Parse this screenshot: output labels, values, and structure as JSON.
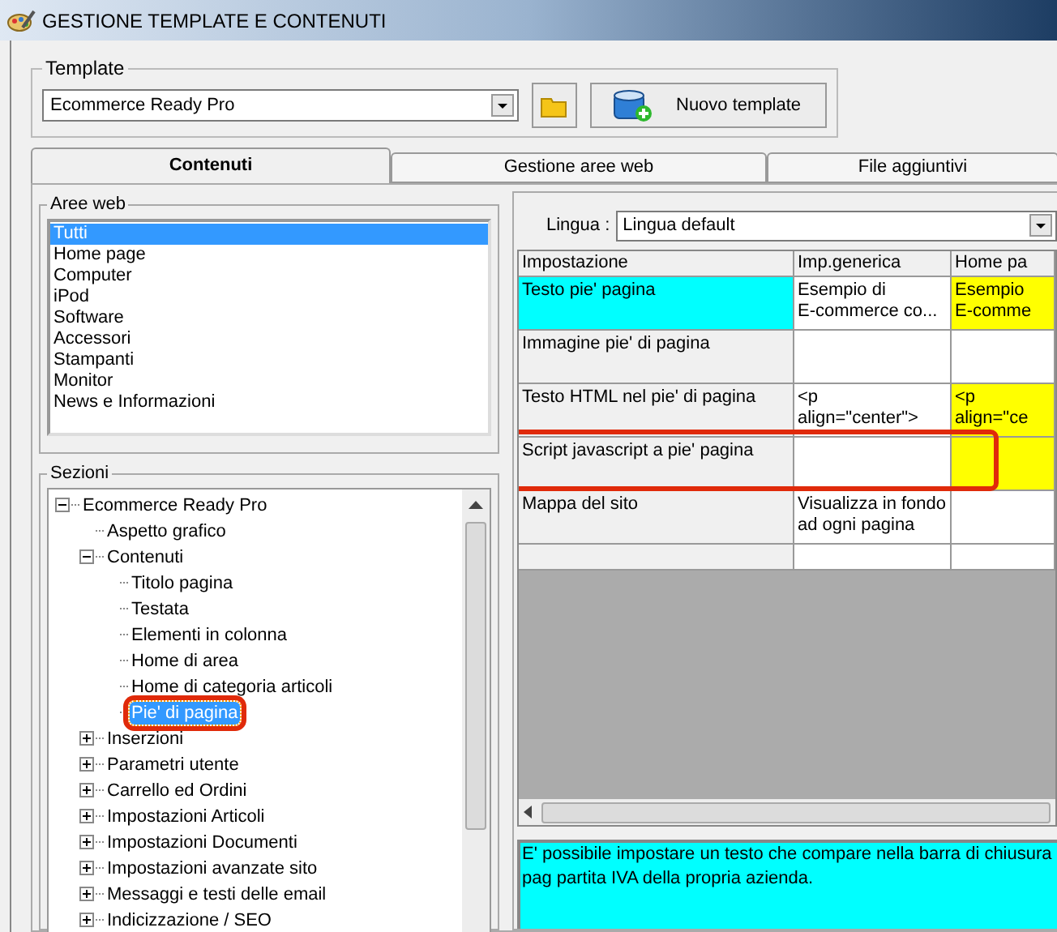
{
  "window": {
    "title": "GESTIONE TEMPLATE E CONTENUTI"
  },
  "template": {
    "label": "Template",
    "value": "Ecommerce Ready Pro",
    "new_button": "Nuovo template"
  },
  "tabs": [
    {
      "label": "Contenuti",
      "selected": true
    },
    {
      "label": "Gestione aree web",
      "selected": false
    },
    {
      "label": "File aggiuntivi",
      "selected": false
    }
  ],
  "aree_web": {
    "label": "Aree web",
    "items": [
      {
        "label": "Tutti",
        "selected": true
      },
      {
        "label": "Home page",
        "selected": false
      },
      {
        "label": "Computer",
        "selected": false
      },
      {
        "label": "iPod",
        "selected": false
      },
      {
        "label": "Software",
        "selected": false
      },
      {
        "label": "Accessori",
        "selected": false
      },
      {
        "label": "Stampanti",
        "selected": false
      },
      {
        "label": "Monitor",
        "selected": false
      },
      {
        "label": "News e Informazioni",
        "selected": false
      }
    ]
  },
  "sezioni": {
    "label": "Sezioni",
    "tree": [
      {
        "label": "Ecommerce Ready Pro",
        "expanded": true,
        "selected": false,
        "children": [
          {
            "label": "Aspetto grafico",
            "selected": false
          },
          {
            "label": "Contenuti",
            "expanded": true,
            "selected": false,
            "children": [
              {
                "label": "Titolo pagina",
                "selected": false
              },
              {
                "label": "Testata",
                "selected": false
              },
              {
                "label": "Elementi in colonna",
                "selected": false
              },
              {
                "label": "Home di area",
                "selected": false
              },
              {
                "label": "Home di categoria articoli",
                "selected": false
              },
              {
                "label": "Pie' di pagina",
                "selected": true,
                "annotated": true
              }
            ]
          },
          {
            "label": "Inserzioni",
            "expanded": false,
            "selected": false
          },
          {
            "label": "Parametri utente",
            "expanded": false,
            "selected": false
          },
          {
            "label": "Carrello ed Ordini",
            "expanded": false,
            "selected": false
          },
          {
            "label": "Impostazioni Articoli",
            "expanded": false,
            "selected": false
          },
          {
            "label": "Impostazioni Documenti",
            "expanded": false,
            "selected": false
          },
          {
            "label": "Impostazioni avanzate sito",
            "expanded": false,
            "selected": false
          },
          {
            "label": "Messaggi e testi delle email",
            "expanded": false,
            "selected": false
          },
          {
            "label": "Indicizzazione / SEO",
            "expanded": false,
            "selected": false
          }
        ]
      }
    ]
  },
  "lingua": {
    "label": "Lingua :",
    "value": "Lingua default"
  },
  "grid": {
    "columns": [
      "Impostazione",
      "Imp.generica",
      "Home pa"
    ],
    "rows": [
      {
        "selected": true,
        "annotated": false,
        "cells": [
          {
            "text": "Testo pie' pagina",
            "highlighted": false
          },
          {
            "text": "Esempio di\nE-commerce co...",
            "highlighted": false
          },
          {
            "text": "Esempio\nE-comme",
            "highlighted": true
          }
        ]
      },
      {
        "selected": false,
        "annotated": false,
        "cells": [
          {
            "text": "Immagine pie' di pagina",
            "highlighted": false
          },
          {
            "text": "",
            "highlighted": false
          },
          {
            "text": "",
            "highlighted": false
          }
        ]
      },
      {
        "selected": false,
        "annotated": false,
        "cells": [
          {
            "text": "Testo HTML nel pie' di pagina",
            "highlighted": false
          },
          {
            "text": "<p\nalign=\"center\">",
            "highlighted": false
          },
          {
            "text": "<p\nalign=\"ce",
            "highlighted": true
          }
        ]
      },
      {
        "selected": false,
        "annotated": true,
        "cells": [
          {
            "text": "Script javascript a pie' pagina",
            "highlighted": false
          },
          {
            "text": "",
            "highlighted": false
          },
          {
            "text": "",
            "highlighted": true
          }
        ]
      },
      {
        "selected": false,
        "annotated": false,
        "cells": [
          {
            "text": "Mappa del sito",
            "highlighted": false
          },
          {
            "text": "Visualizza in fondo\nad ogni pagina",
            "highlighted": false
          },
          {
            "text": "",
            "highlighted": false
          }
        ]
      }
    ]
  },
  "description": "E' possibile impostare un testo che compare nella barra di chiusura pag partita IVA della propria azienda."
}
